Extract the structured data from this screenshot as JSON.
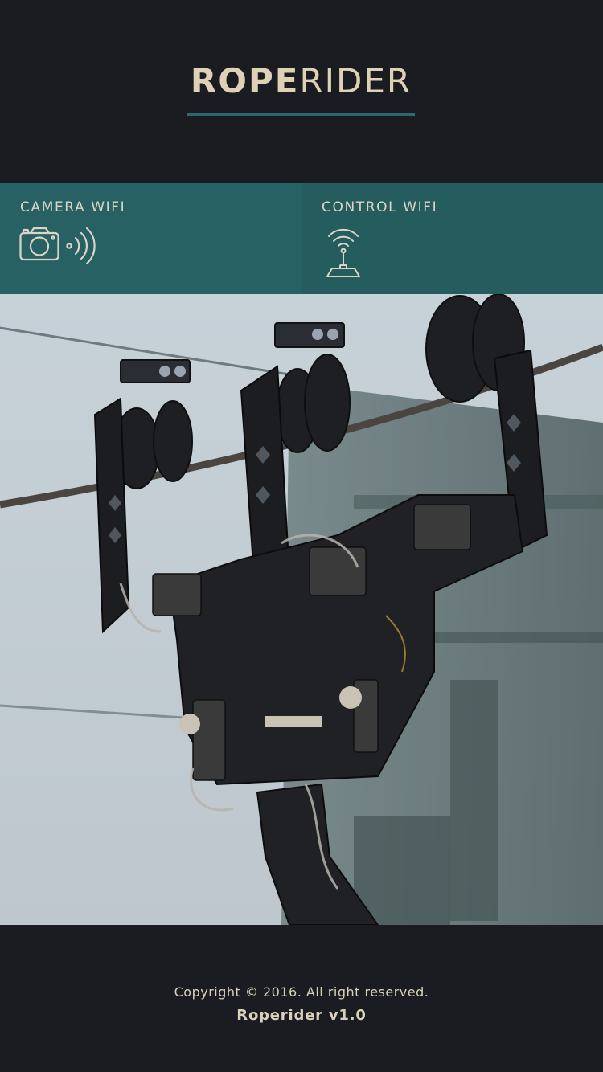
{
  "header": {
    "logo_bold": "ROPE",
    "logo_light": "RIDER"
  },
  "panels": {
    "camera": {
      "label": "CAMERA WIFI",
      "icon": "camera-wifi-icon"
    },
    "control": {
      "label": "CONTROL WIFI",
      "icon": "joystick-wifi-icon"
    }
  },
  "photo": {
    "subject": "cable-cam-robot-on-rope"
  },
  "footer": {
    "copyright": "Copyright © 2016. All right reserved.",
    "version": "Roperider v1.0"
  },
  "colors": {
    "background": "#1b1c21",
    "accent_teal": "#276163",
    "logo_text": "#ddd2b5",
    "underline": "#2e6a6b"
  }
}
